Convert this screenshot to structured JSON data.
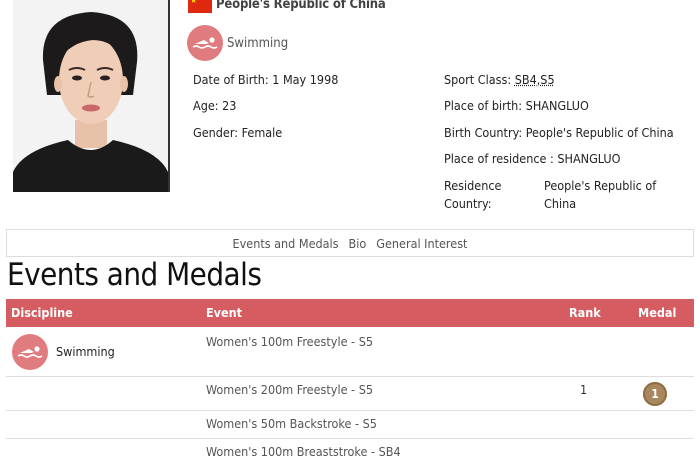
{
  "athlete": {
    "country": "People's Republic of China",
    "sport": "Swimming"
  },
  "info_left": [
    {
      "label": "Date of Birth:",
      "value": "1 May 1998"
    },
    {
      "label": "Age:",
      "value": "23"
    },
    {
      "label": "Gender:",
      "value": "Female"
    }
  ],
  "info_right": {
    "sport_class_label": "Sport Class:",
    "sport_class_value": "SB4,S5",
    "place_of_birth_label": "Place of birth:",
    "place_of_birth_value": "SHANGLUO",
    "birth_country_label": "Birth Country:",
    "birth_country_value": "People's Republic of China",
    "place_of_residence_label": "Place of residence :",
    "place_of_residence_value": "SHANGLUO",
    "residence_country_label_1": "Residence",
    "residence_country_label_2": "Country:",
    "residence_country_value_1": "People's Republic of",
    "residence_country_value_2": "China"
  },
  "tabs": [
    "Events and Medals",
    "Bio",
    "General Interest"
  ],
  "section_title": "Events and Medals",
  "table": {
    "headers": {
      "discipline": "Discipline",
      "event": "Event",
      "rank": "Rank",
      "medal": "Medal"
    },
    "rows": [
      {
        "discipline": "Swimming",
        "event": "Women's 100m Freestyle - S5",
        "rank": "",
        "medal": ""
      },
      {
        "discipline": "",
        "event": "Women's 200m Freestyle - S5",
        "rank": "1",
        "medal": "1"
      },
      {
        "discipline": "",
        "event": "Women's 50m Backstroke - S5",
        "rank": "",
        "medal": ""
      },
      {
        "discipline": "",
        "event": "Women's 100m Breaststroke - SB4",
        "rank": "",
        "medal": ""
      }
    ]
  },
  "colors": {
    "accent": "#d55c61",
    "sport_icon": "#e07b7f",
    "gold_medal": "#a8875e",
    "flag_red": "#de2910"
  },
  "icons": {
    "sport": "swimmer-icon",
    "medal": "gold-medal-icon",
    "flag": "china-flag-icon"
  }
}
